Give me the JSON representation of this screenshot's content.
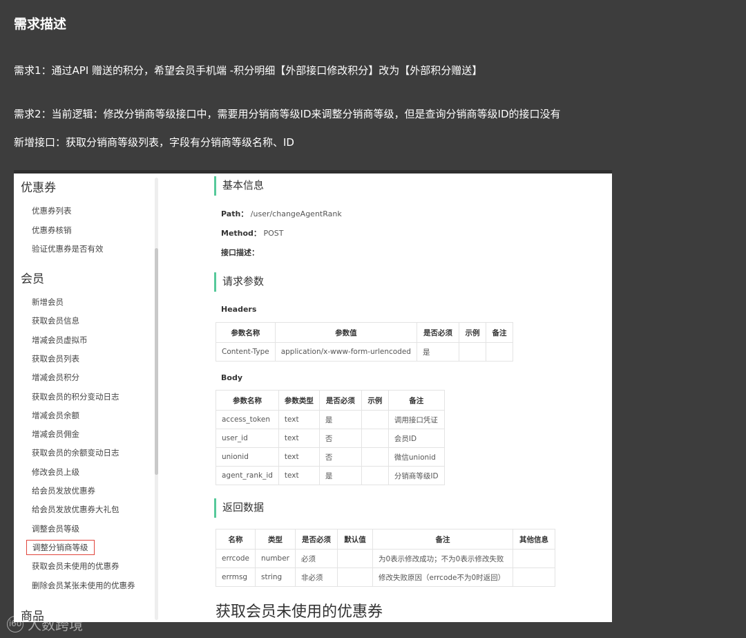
{
  "doc": {
    "title": "需求描述",
    "req1": "需求1：通过API 赠送的积分，希望会员手机端 -积分明细【外部接口修改积分】改为【外部积分赠送】",
    "req2": "需求2：当前逻辑：修改分销商等级接口中，需要用分销商等级ID来调整分销商等级，但是查询分销商等级ID的接口没有",
    "req3": "新增接口：获取分销商等级列表，字段有分销商等级名称、ID"
  },
  "sidebar": {
    "group_coupon": "优惠券",
    "coupon_items": [
      "优惠券列表",
      "优惠券核销",
      "验证优惠券是否有效"
    ],
    "group_member": "会员",
    "member_items": [
      "新增会员",
      "获取会员信息",
      "增减会员虚拟币",
      "获取会员列表",
      "增减会员积分",
      "获取会员的积分变动日志",
      "增减会员余额",
      "增减会员佣金",
      "获取会员的余额变动日志",
      "修改会员上级",
      "给会员发放优惠券",
      "给会员发放优惠券大礼包",
      "调整会员等级",
      "调整分销商等级",
      "获取会员未使用的优惠券",
      "删除会员某张未使用的优惠券"
    ],
    "group_goods": "商品"
  },
  "api": {
    "sec_basic": "基本信息",
    "path_label": "Path：",
    "path_value": "/user/changeAgentRank",
    "method_label": "Method：",
    "method_value": "POST",
    "desc_label": "接口描述：",
    "sec_request": "请求参数",
    "headers_label": "Headers",
    "headers_cols": [
      "参数名称",
      "参数值",
      "是否必须",
      "示例",
      "备注"
    ],
    "headers_rows": [
      [
        "Content-Type",
        "application/x-www-form-urlencoded",
        "是",
        "",
        ""
      ]
    ],
    "body_label": "Body",
    "body_cols": [
      "参数名称",
      "参数类型",
      "是否必须",
      "示例",
      "备注"
    ],
    "body_rows": [
      [
        "access_token",
        "text",
        "是",
        "",
        "调用接口凭证"
      ],
      [
        "user_id",
        "text",
        "否",
        "",
        "会员ID"
      ],
      [
        "unionid",
        "text",
        "否",
        "",
        "微信unionid"
      ],
      [
        "agent_rank_id",
        "text",
        "是",
        "",
        "分销商等级ID"
      ]
    ],
    "sec_return": "返回数据",
    "return_cols": [
      "名称",
      "类型",
      "是否必须",
      "默认值",
      "备注",
      "其他信息"
    ],
    "return_rows": [
      [
        "errcode",
        "number",
        "必须",
        "",
        "为0表示修改成功；不为0表示修改失败",
        ""
      ],
      [
        "errmsg",
        "string",
        "非必须",
        "",
        "修改失败原因（errcode不为0时返回）",
        ""
      ]
    ],
    "next_title": "获取会员未使用的优惠券"
  },
  "watermark": {
    "logo": "i6o",
    "text": "人数跨境"
  }
}
